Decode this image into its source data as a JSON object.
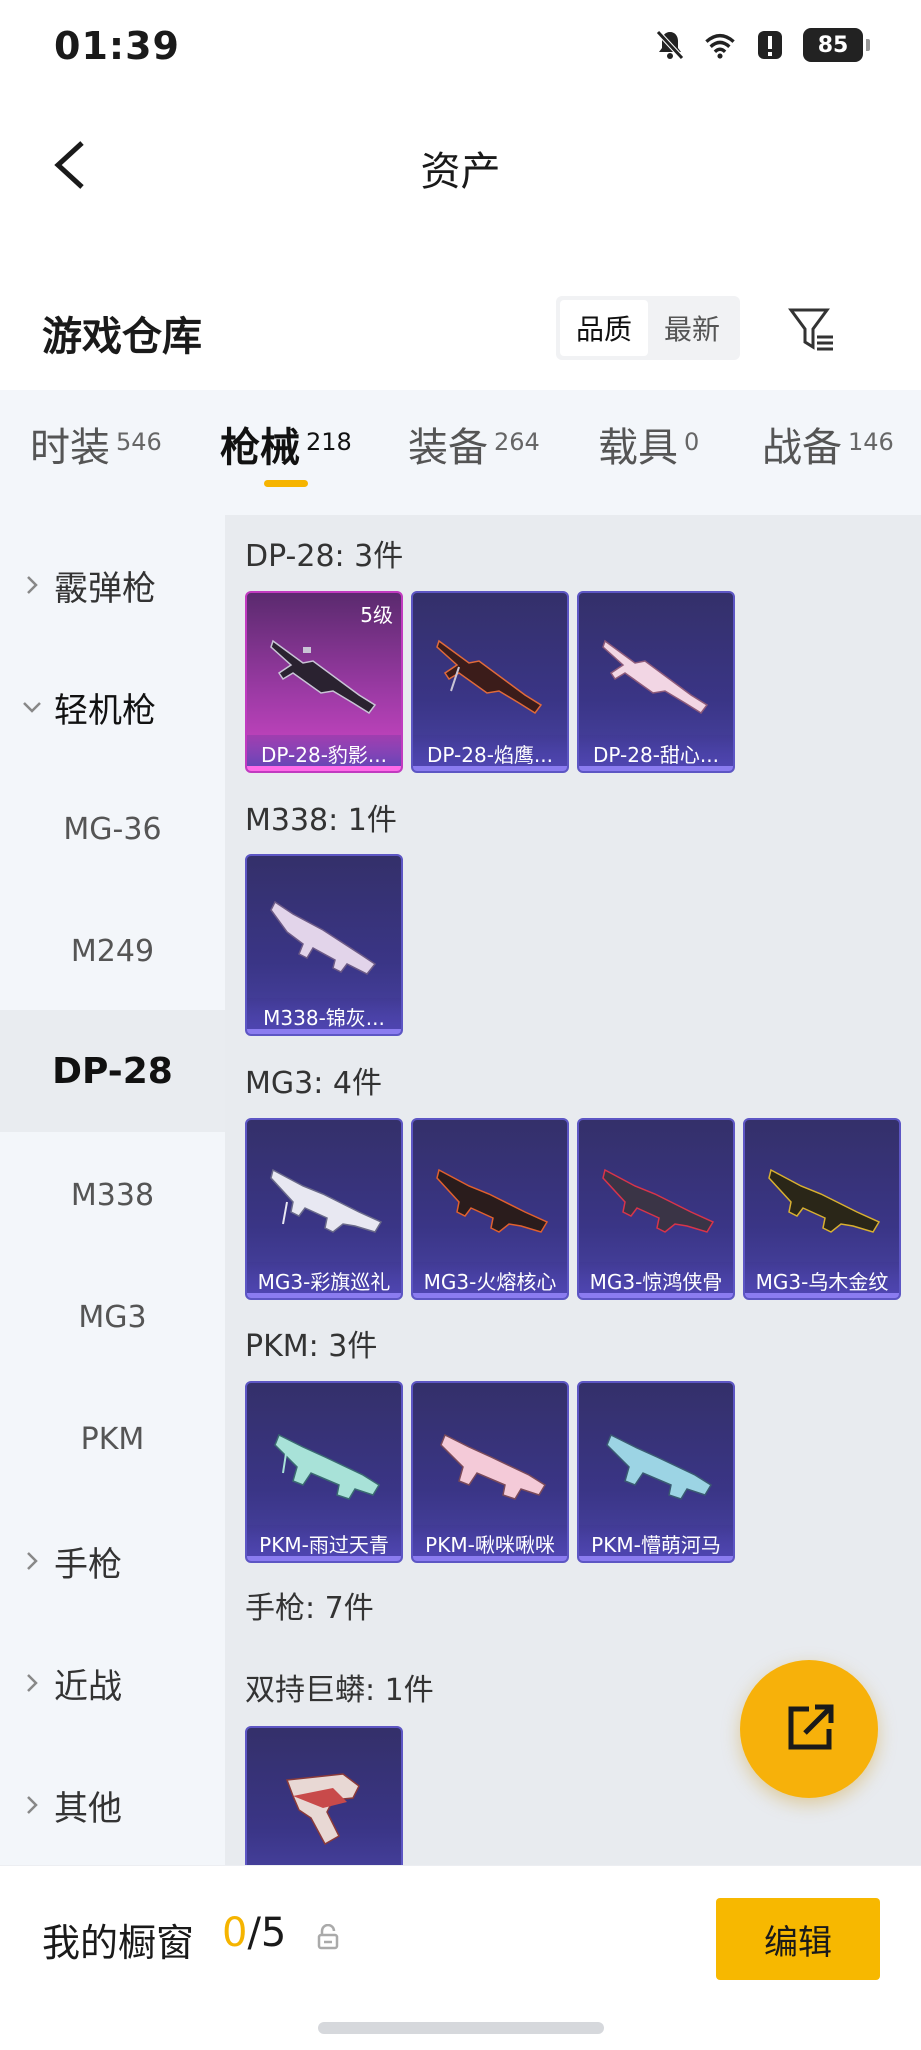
{
  "status_bar": {
    "time": "01:39",
    "battery": "85"
  },
  "header": {
    "title": "资产"
  },
  "section": {
    "title": "游戏仓库",
    "sort_options": [
      "品质",
      "最新"
    ]
  },
  "tabs": [
    {
      "label": "时装",
      "count": "546"
    },
    {
      "label": "枪械",
      "count": "218"
    },
    {
      "label": "装备",
      "count": "264"
    },
    {
      "label": "载具",
      "count": "0"
    },
    {
      "label": "战备",
      "count": "146"
    }
  ],
  "sidebar": [
    {
      "label": "霰弹枪"
    },
    {
      "label": "轻机枪"
    },
    {
      "label": "MG-36"
    },
    {
      "label": "M249"
    },
    {
      "label": "DP-28"
    },
    {
      "label": "M338"
    },
    {
      "label": "MG3"
    },
    {
      "label": "PKM"
    },
    {
      "label": "手枪"
    },
    {
      "label": "近战"
    },
    {
      "label": "其他"
    }
  ],
  "groups": [
    {
      "title": "DP-28: 3件",
      "items": [
        {
          "name": "DP-28-豹影...",
          "level": "5级"
        },
        {
          "name": "DP-28-焰鹰..."
        },
        {
          "name": "DP-28-甜心..."
        }
      ]
    },
    {
      "title": "M338: 1件",
      "items": [
        {
          "name": "M338-锦灰..."
        }
      ]
    },
    {
      "title": "MG3: 4件",
      "items": [
        {
          "name": "MG3-彩旗巡礼"
        },
        {
          "name": "MG3-火熔核心"
        },
        {
          "name": "MG3-惊鸿侠骨"
        },
        {
          "name": "MG3-乌木金纹"
        }
      ]
    },
    {
      "title": "PKM: 3件",
      "items": [
        {
          "name": "PKM-雨过天青"
        },
        {
          "name": "PKM-啾咪啾咪"
        },
        {
          "name": "PKM-懵萌河马"
        }
      ]
    },
    {
      "title": "手枪: 7件",
      "items": []
    },
    {
      "title": "双持巨蟒: 1件",
      "items": [
        {
          "name": ""
        }
      ]
    }
  ],
  "showcase": {
    "label": "我的橱窗",
    "current": "0",
    "total": "/5",
    "edit_label": "编辑"
  },
  "colors": {
    "accent": "#f7b800",
    "epic_card": "#3a3586",
    "legend_card": "#c13bc0"
  }
}
